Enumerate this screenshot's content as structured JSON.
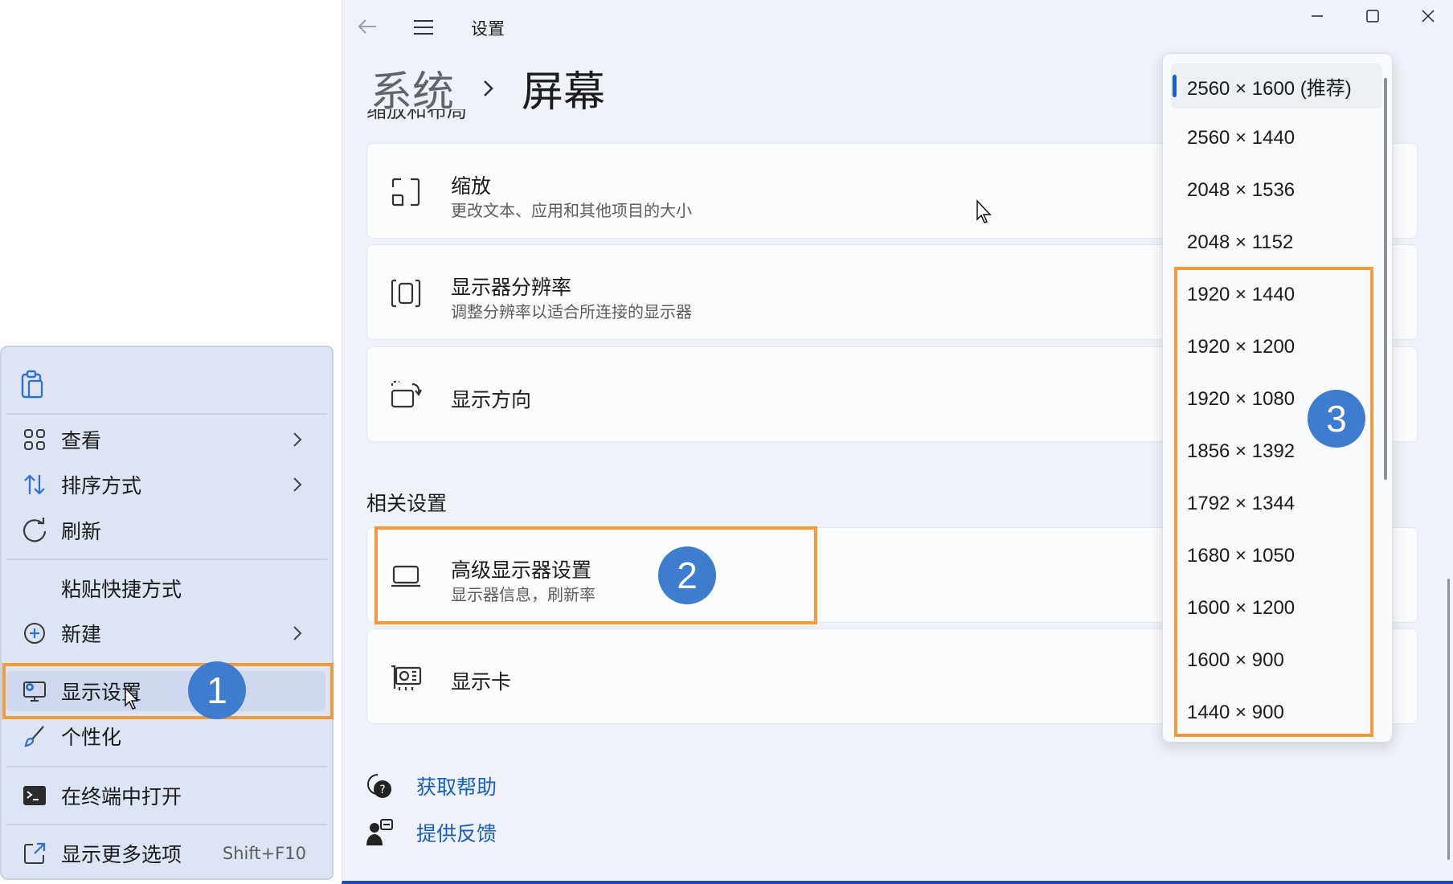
{
  "context_menu": {
    "items": [
      {
        "label": "查看",
        "icon": "grid-view-icon",
        "has_submenu": true
      },
      {
        "label": "排序方式",
        "icon": "sort-arrows-icon",
        "has_submenu": true
      },
      {
        "label": "刷新",
        "icon": "refresh-icon",
        "has_submenu": false
      },
      {
        "label": "粘贴快捷方式",
        "icon": "",
        "has_submenu": false
      },
      {
        "label": "新建",
        "icon": "plus-circle-icon",
        "has_submenu": true
      },
      {
        "label": "显示设置",
        "icon": "display-settings-icon",
        "has_submenu": false
      },
      {
        "label": "个性化",
        "icon": "brush-icon",
        "has_submenu": false
      },
      {
        "label": "在终端中打开",
        "icon": "terminal-icon",
        "has_submenu": false
      },
      {
        "label": "显示更多选项",
        "icon": "share-icon",
        "shortcut": "Shift+F10"
      }
    ]
  },
  "annotations": {
    "badge1": "1",
    "badge2": "2",
    "badge3": "3",
    "highlight_color": "#f39a3a",
    "badge_color": "#3d7ccf"
  },
  "window": {
    "title": "设置",
    "breadcrumb": {
      "parent": "系统",
      "current": "屏幕"
    },
    "cut_section_label": "缩放和布局",
    "cards": [
      {
        "title": "缩放",
        "subtitle": "更改文本、应用和其他项目的大小",
        "icon": "scale-icon"
      },
      {
        "title": "显示器分辨率",
        "subtitle": "调整分辨率以适合所连接的显示器",
        "icon": "resolution-icon"
      },
      {
        "title": "显示方向",
        "subtitle": "",
        "icon": "orientation-icon"
      }
    ],
    "related_settings_header": "相关设置",
    "related_cards": [
      {
        "title": "高级显示器设置",
        "subtitle": "显示器信息，刷新率",
        "icon": "monitor-icon"
      },
      {
        "title": "显示卡",
        "subtitle": "",
        "icon": "graphics-card-icon"
      }
    ],
    "links": [
      {
        "label": "获取帮助",
        "icon": "help-icon"
      },
      {
        "label": "提供反馈",
        "icon": "feedback-icon"
      }
    ],
    "accent_color": "#1a5fb4"
  },
  "resolution_dropdown": {
    "selected_index": 0,
    "options": [
      "2560 × 1600 (推荐)",
      "2560 × 1440",
      "2048 × 1536",
      "2048 × 1152",
      "1920 × 1440",
      "1920 × 1200",
      "1920 × 1080",
      "1856 × 1392",
      "1792 × 1344",
      "1680 × 1050",
      "1600 × 1200",
      "1600 × 900",
      "1440 × 900"
    ]
  }
}
